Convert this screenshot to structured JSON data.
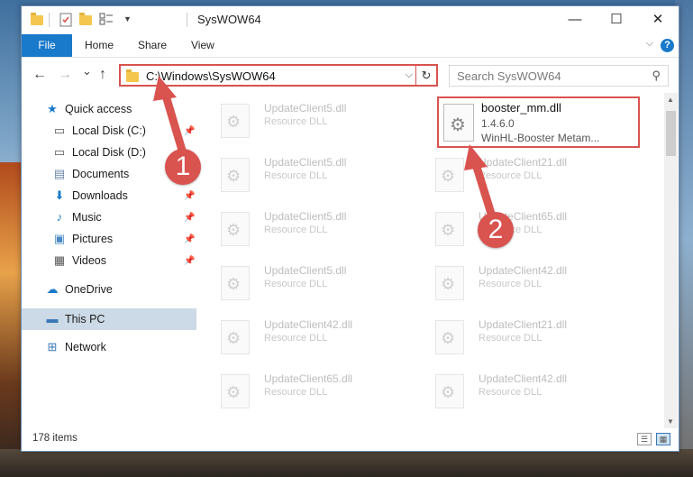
{
  "window": {
    "title": "SysWOW64",
    "minimize": "—",
    "maximize": "☐",
    "close": "✕"
  },
  "ribbon": {
    "tabs": [
      "File",
      "Home",
      "Share",
      "View"
    ],
    "help": "?"
  },
  "navigation": {
    "back": "←",
    "forward": "→",
    "recent": "⌄",
    "up": "↑",
    "address": "C:\\Windows\\SysWOW64",
    "search_placeholder": "Search SysWOW64"
  },
  "sidebar": {
    "items": [
      {
        "label": "Quick access",
        "icon": "star-icon",
        "pinned": false
      },
      {
        "label": "Local Disk (C:)",
        "icon": "drive-icon",
        "pinned": true
      },
      {
        "label": "Local Disk (D:)",
        "icon": "drive-icon",
        "pinned": false
      },
      {
        "label": "Documents",
        "icon": "documents-icon",
        "pinned": true
      },
      {
        "label": "Downloads",
        "icon": "download-icon",
        "pinned": true
      },
      {
        "label": "Music",
        "icon": "music-icon",
        "pinned": true
      },
      {
        "label": "Pictures",
        "icon": "pictures-icon",
        "pinned": true
      },
      {
        "label": "Videos",
        "icon": "videos-icon",
        "pinned": true
      },
      {
        "label": "OneDrive",
        "icon": "cloud-icon",
        "pinned": false
      },
      {
        "label": "This PC",
        "icon": "computer-icon",
        "pinned": false,
        "selected": true
      },
      {
        "label": "Network",
        "icon": "network-icon",
        "pinned": false
      }
    ]
  },
  "files": {
    "highlighted": {
      "name": "booster_mm.dll",
      "version": "1.4.6.0",
      "description": "WinHL-Booster Metam..."
    },
    "left_column": [
      {
        "name": "UpdateClient5.dll",
        "desc": "Resource DLL"
      },
      {
        "name": "UpdateClient5.dll",
        "desc": "Resource DLL"
      },
      {
        "name": "UpdateClient5.dll",
        "desc": "Resource DLL"
      },
      {
        "name": "UpdateClient5.dll",
        "desc": "Resource DLL"
      },
      {
        "name": "UpdateClient42.dll",
        "desc": "Resource DLL"
      },
      {
        "name": "UpdateClient65.dll",
        "desc": "Resource DLL"
      }
    ],
    "right_column": [
      {
        "name": "UpdateClient21.dll",
        "desc": "Resource DLL"
      },
      {
        "name": "UpdateClient65.dll",
        "desc": "Resource DLL"
      },
      {
        "name": "UpdateClient42.dll",
        "desc": "Resource DLL"
      },
      {
        "name": "UpdateClient21.dll",
        "desc": "Resource DLL"
      },
      {
        "name": "UpdateClient42.dll",
        "desc": "Resource DLL"
      }
    ]
  },
  "status": {
    "item_count": "178 items"
  },
  "annotations": {
    "step1": "1",
    "step2": "2"
  },
  "colors": {
    "accent": "#1979ca",
    "highlight_border": "#d9534f",
    "annotation": "#d9534f",
    "selected_bg": "#ccd9e6"
  }
}
